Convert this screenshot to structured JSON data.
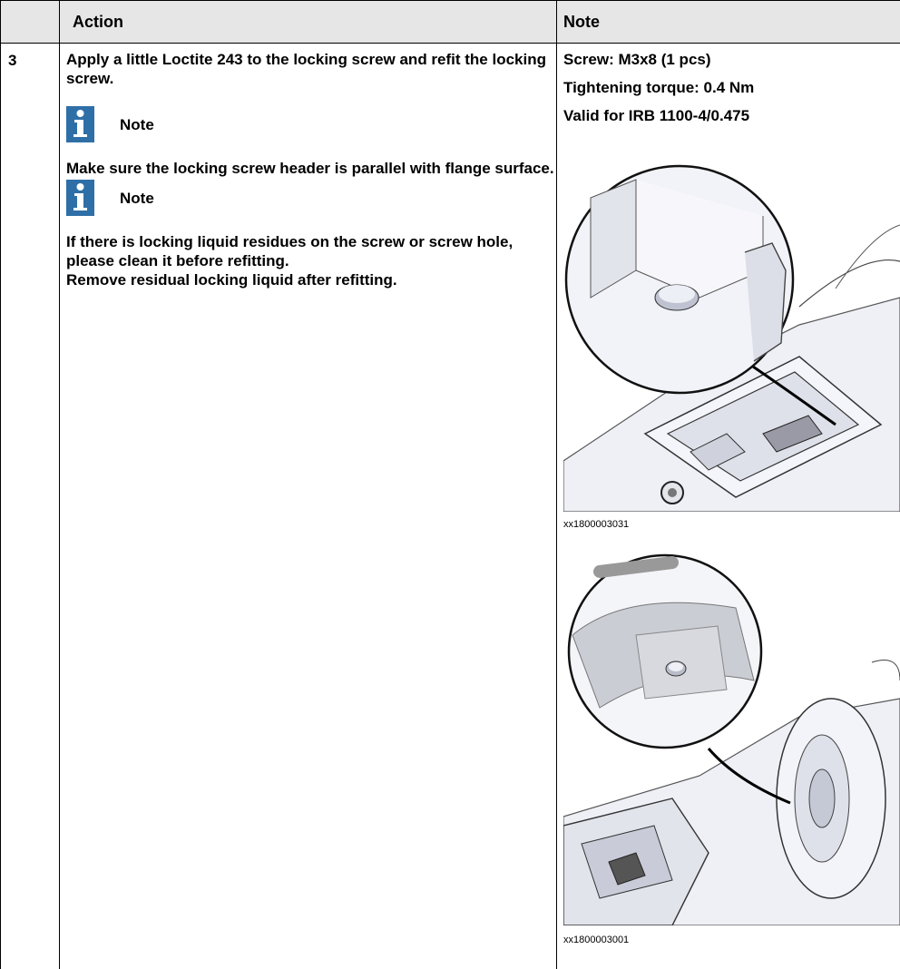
{
  "header": {
    "action_label": "Action",
    "note_label": "Note"
  },
  "row": {
    "step_number": "3",
    "action": {
      "instruction": "Apply a little Loctite 243 to the locking screw and refit the locking screw.",
      "note1_title": "Note",
      "note1_text": "Make sure the locking screw header is parallel with flange surface.",
      "note2_title": "Note",
      "note2_text1": "If there is locking liquid residues on the screw or screw hole, please clean it before refitting.",
      "note2_text2": "Remove residual locking liquid after refitting."
    },
    "note": {
      "screw": "Screw: M3x8 (1 pcs)",
      "torque": "Tightening torque: 0.4 Nm",
      "valid_for": "Valid for IRB 1100-4/0.475",
      "figure1_caption": "xx1800003031",
      "figure2_caption": "xx1800003001"
    }
  },
  "colors": {
    "header_bg": "#e6e6e6",
    "note_icon": "#2f6fa7"
  }
}
